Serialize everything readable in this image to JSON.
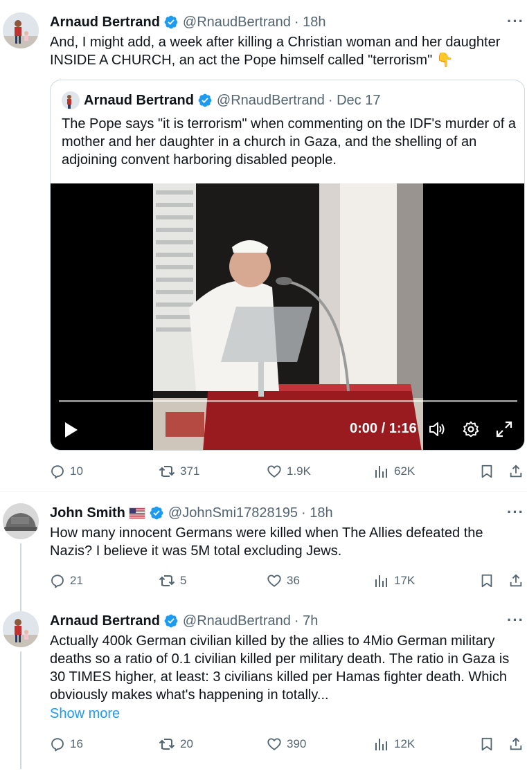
{
  "tweet1": {
    "author": "Arnaud Bertrand",
    "handle": "@RnaudBertrand",
    "time": "· 18h",
    "more": "···",
    "text": "And, I might add, a week after killing a Christian woman and her daughter INSIDE A CHURCH, an act the Pope himself called \"terrorism\" 👇",
    "quote": {
      "author": "Arnaud Bertrand",
      "handle": "@RnaudBertrand",
      "time": "· Dec 17",
      "text": "The Pope says \"it is terrorism\" when commenting on the IDF's murder of a mother and her daughter in a church in Gaza, and the shelling of an adjoining convent harboring disabled people.",
      "video": {
        "time": "0:00 / 1:16",
        "progress": 0
      }
    },
    "stats": {
      "replies": "10",
      "reposts": "371",
      "likes": "1.9K",
      "views": "62K"
    }
  },
  "tweet2": {
    "author": "John Smith",
    "handle": "@JohnSmi17828195",
    "time": "· 18h",
    "more": "···",
    "text": "How many innocent Germans were killed when The Allies defeated the Nazis?  I believe it was 5M total excluding Jews.",
    "stats": {
      "replies": "21",
      "reposts": "5",
      "likes": "36",
      "views": "17K"
    }
  },
  "tweet3": {
    "author": "Arnaud Bertrand",
    "handle": "@RnaudBertrand",
    "time": "· 7h",
    "more": "···",
    "text": "Actually 400k German civilian killed by the allies to 4Mio German military deaths so a ratio of 0.1 civilian killed per military death. The ratio in Gaza is 30 TIMES higher, at least: 3 civilians killed per Hamas fighter death. Which obviously makes what's happening in totally...",
    "show_more": "Show more",
    "stats": {
      "replies": "16",
      "reposts": "20",
      "likes": "390",
      "views": "12K"
    }
  },
  "colors": {
    "accent": "#1d9bf0",
    "text": "#0f1419",
    "muted": "#536471",
    "border": "#cfd9de"
  }
}
